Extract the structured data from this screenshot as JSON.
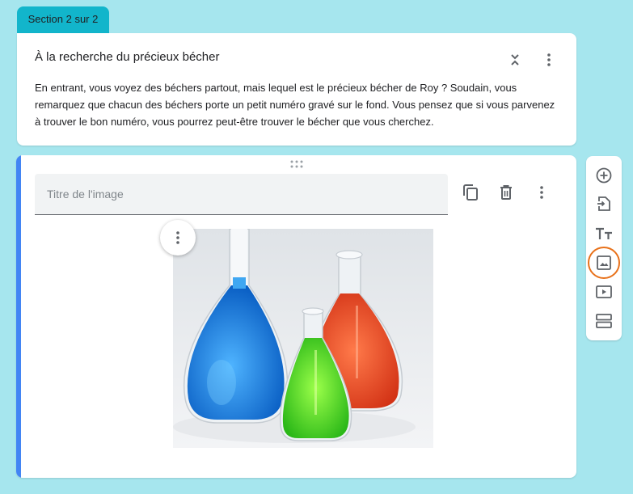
{
  "section": {
    "badge": "Section 2 sur 2",
    "title": "À la recherche du précieux bécher",
    "description": "En entrant, vous voyez des béchers partout, mais lequel est le précieux bécher de Roy ? Soudain, vous remarquez que chacun des béchers porte un petit numéro gravé sur le fond. Vous pensez que si vous parvenez à trouver le bon numéro, vous pourrez peut-être trouver le bécher que vous cherchez."
  },
  "image_item": {
    "title_value": "",
    "title_placeholder": "Titre de l'image",
    "image_icon": "lab-flasks-photo"
  },
  "toolbar": {
    "items": [
      {
        "icon": "add-question-icon"
      },
      {
        "icon": "import-questions-icon"
      },
      {
        "icon": "add-title-icon"
      },
      {
        "icon": "add-image-icon",
        "highlighted": true
      },
      {
        "icon": "add-video-icon"
      },
      {
        "icon": "add-section-icon"
      }
    ]
  },
  "colors": {
    "background": "#a6e6ee",
    "section_tab": "#12b5cb",
    "accent": "#4285f4",
    "highlight_ring": "#e8711a"
  }
}
